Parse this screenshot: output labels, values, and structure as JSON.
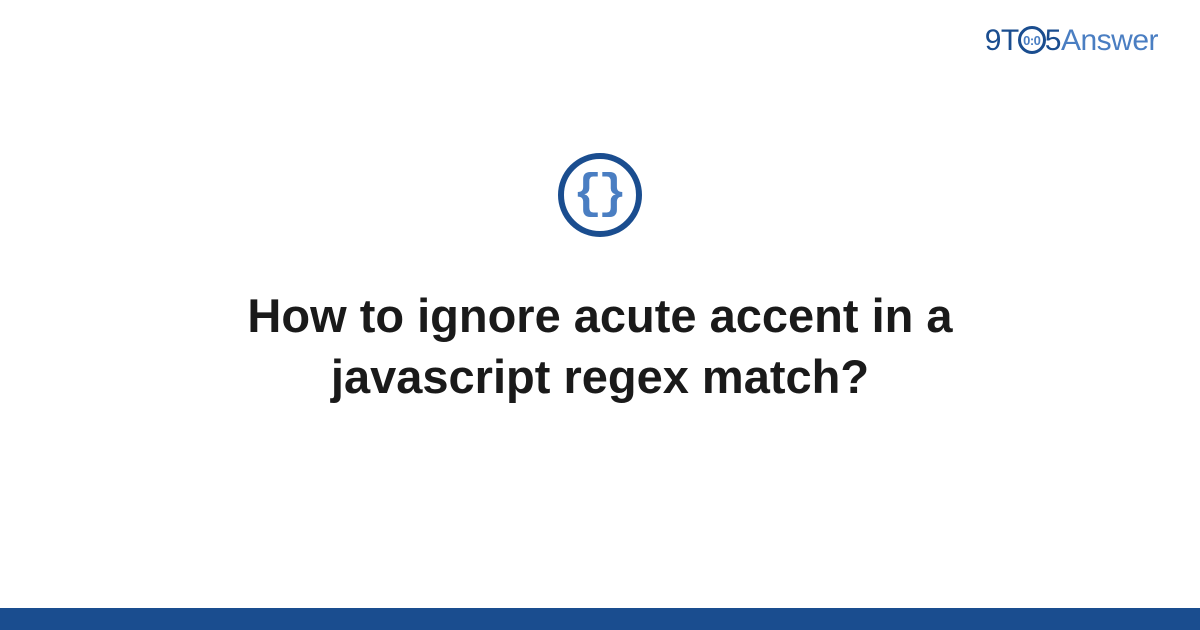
{
  "logo": {
    "prefix": "9T",
    "circle_text": "0:0",
    "middle": "5",
    "suffix": "Answer"
  },
  "icon": {
    "left_brace": "{",
    "right_brace": "}"
  },
  "title": "How to ignore acute accent in a javascript regex match?",
  "colors": {
    "dark_blue": "#1a4d8f",
    "light_blue": "#4a7ec2",
    "text": "#1a1a1a"
  }
}
